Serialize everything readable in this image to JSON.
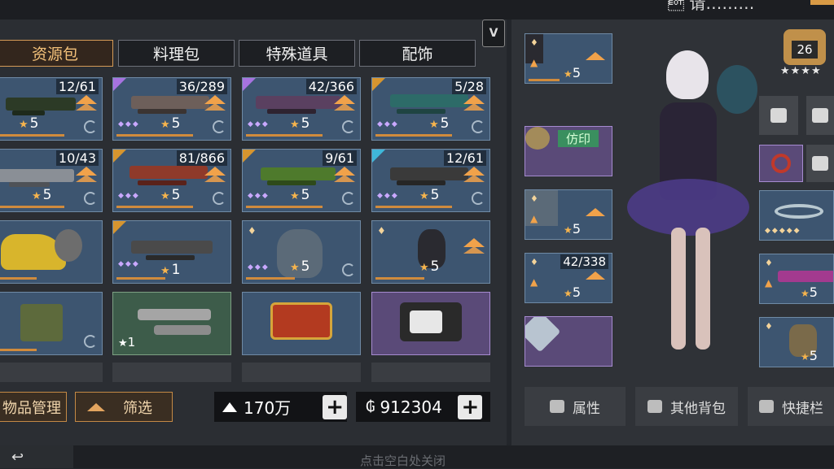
{
  "top": {
    "right_text": "\u0004 请………"
  },
  "tabs": [
    "资源包",
    "料理包",
    "特殊道具",
    "配饰"
  ],
  "vip_badge": "V",
  "grid": [
    {
      "count": "12/61",
      "level": "5"
    },
    {
      "count": "36/289",
      "level": "5"
    },
    {
      "count": "42/366",
      "level": "5"
    },
    {
      "count": "5/28",
      "level": "5"
    },
    {
      "count": "10/43",
      "level": "5"
    },
    {
      "count": "81/866",
      "level": "5"
    },
    {
      "count": "9/61",
      "level": "5"
    },
    {
      "count": "12/61",
      "level": "5"
    },
    {
      "count": "",
      "level": ""
    },
    {
      "count": "",
      "level": "1"
    },
    {
      "count": "",
      "level": "5"
    },
    {
      "count": "",
      "level": "5"
    },
    {
      "count": "",
      "level": ""
    },
    {
      "count": "",
      "level": "1"
    },
    {
      "count": "",
      "level": ""
    },
    {
      "count": "",
      "level": ""
    }
  ],
  "bottom": {
    "manage_label": "物品管理",
    "filter_label": "筛选",
    "currency1": "170万",
    "currency2": "912304"
  },
  "equip": {
    "slot1_level": "5",
    "imprint_label": "仿印",
    "slot3_level": "5",
    "slot4_count": "42/338",
    "slot4_level": "5",
    "side_level1": "5",
    "side_level2": "5"
  },
  "rank": "26",
  "right_buttons": [
    "属性",
    "其他背包",
    "快捷栏"
  ],
  "bottom_hint": "点击空白处关闭"
}
